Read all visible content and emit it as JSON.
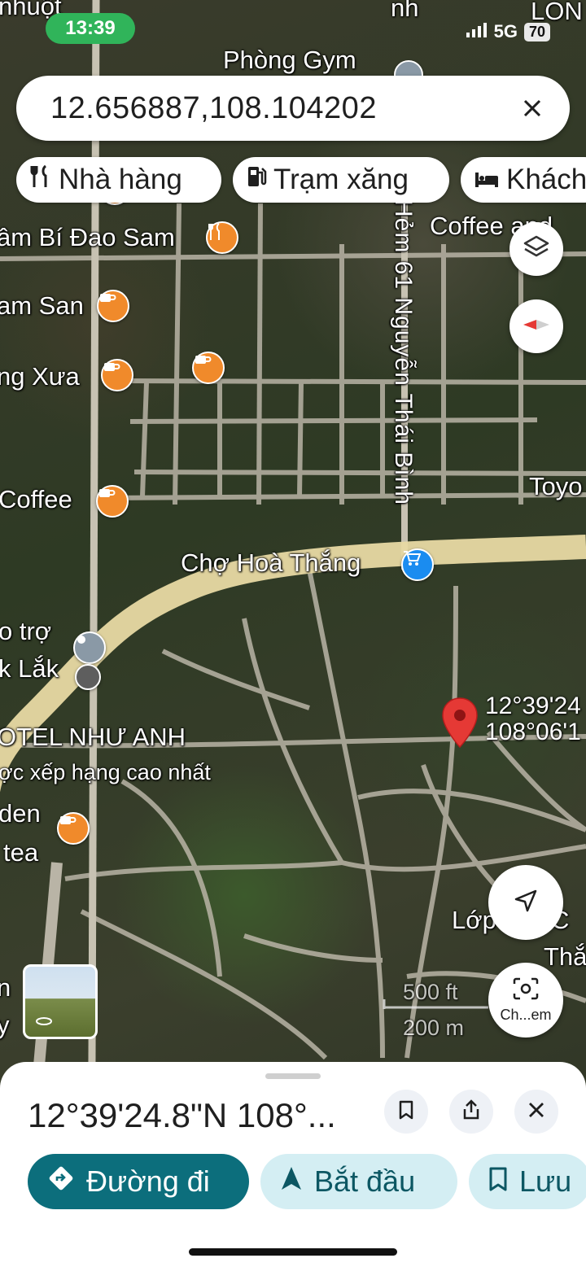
{
  "status_bar": {
    "time": "13:39",
    "network": "5G",
    "battery": "70"
  },
  "search": {
    "query": "12.656887,108.104202"
  },
  "chips": [
    {
      "label": "Nhà hàng",
      "icon": "restaurant-icon"
    },
    {
      "label": "Trạm xăng",
      "icon": "gas-station-icon"
    },
    {
      "label": "Khách",
      "icon": "hotel-icon"
    }
  ],
  "map": {
    "labels": {
      "top_left": "nhuột",
      "top_right": "LON",
      "gym": "Phòng Gym",
      "top_street": "nh",
      "bi_dao": "âm Bí Đao Sam",
      "coffee_and": "Coffee and",
      "am_san": "am San",
      "ng_xua": "ng Xưa",
      "coffee_left": "Coffee",
      "toyo": "Toyo",
      "vertical_street": "Hẻm 61 Nguyễn Thái Bình",
      "market": "Chợ Hoà Thắng",
      "o_tro": "o trợ",
      "k_lak": "k Lắk",
      "hotel": "OTEL NHƯ ANH",
      "hotel_sub": "ợc xếp hạng cao nhất",
      "den": "den",
      "tea": "tea",
      "lop": "Lớp học C",
      "tha": "Thắ",
      "n_left": "n",
      "y_left": "y",
      "pin_lat": "12°39'24",
      "pin_lng": "108°06'1",
      "scale_ft": "500 ft",
      "scale_m": "200 m"
    },
    "screenshot_label": "Ch...em",
    "colors": {
      "poi_food": "#f08a2b",
      "poi_market": "#1a8cf0",
      "pin": "#e53935",
      "road": "#b9b4a6",
      "highway": "#e8d9a3"
    }
  },
  "sheet": {
    "title": "12°39'24.8\"N 108°...",
    "actions": [
      {
        "label": "Đường đi",
        "icon": "directions-icon"
      },
      {
        "label": "Bắt đầu",
        "icon": "navigation-arrow-icon"
      },
      {
        "label": "Lưu",
        "icon": "bookmark-icon"
      }
    ]
  }
}
